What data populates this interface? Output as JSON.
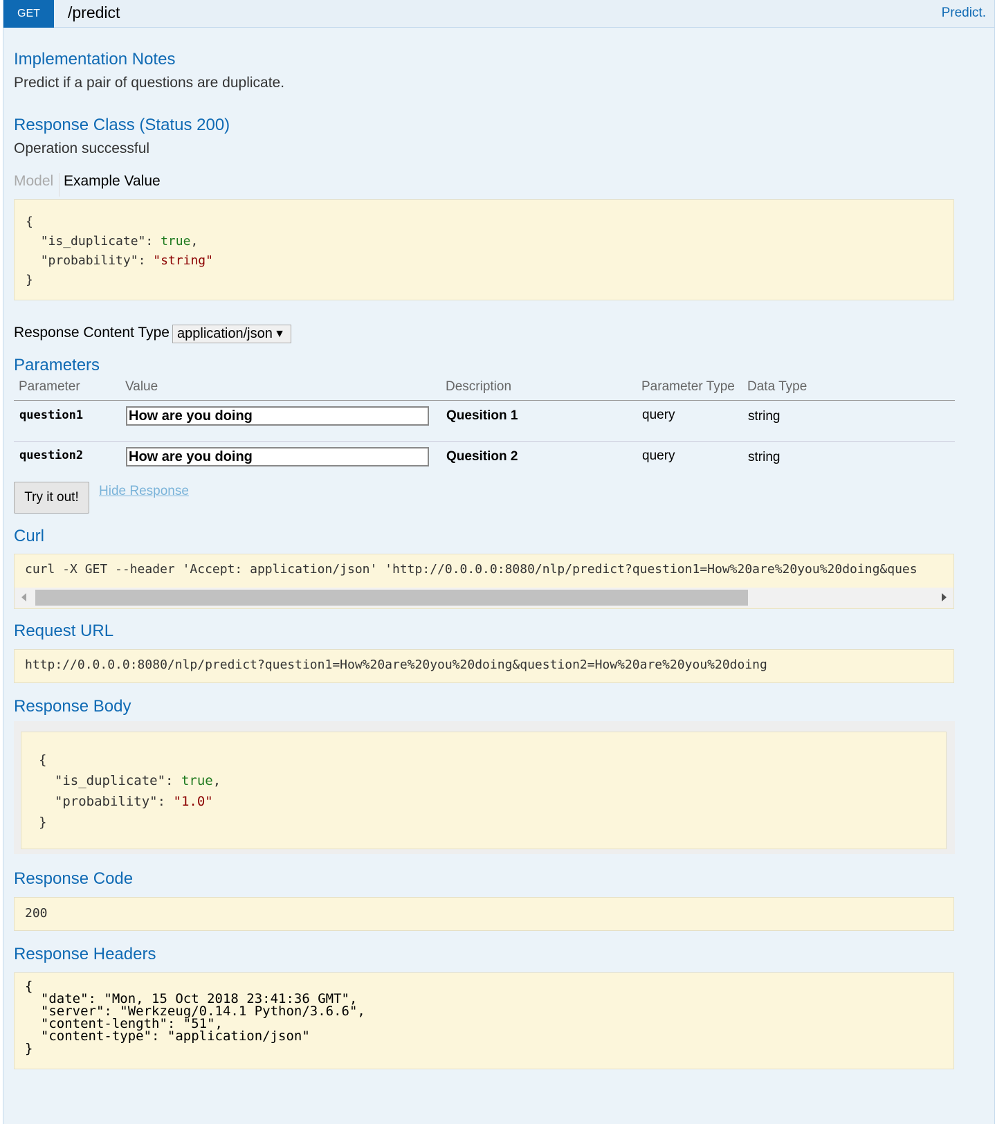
{
  "header": {
    "method": "GET",
    "path": "/predict",
    "summary": "Predict."
  },
  "implementation_notes": {
    "title": "Implementation Notes",
    "text": "Predict if a pair of questions are duplicate."
  },
  "response_class": {
    "title": "Response Class (Status 200)",
    "text": "Operation successful",
    "tabs": {
      "model": "Model",
      "example": "Example Value"
    },
    "example": {
      "open": "{",
      "key1": "\"is_duplicate\"",
      "val1": "true",
      "key2": "\"probability\"",
      "val2": "\"string\"",
      "close": "}"
    }
  },
  "content_type": {
    "label": "Response Content Type",
    "selected": "application/json",
    "arrow": "▼"
  },
  "parameters": {
    "title": "Parameters",
    "columns": [
      "Parameter",
      "Value",
      "Description",
      "Parameter Type",
      "Data Type"
    ],
    "rows": [
      {
        "name": "question1",
        "value": "How are you doing",
        "description": "Quesition 1",
        "param_type": "query",
        "data_type": "string"
      },
      {
        "name": "question2",
        "value": "How are you doing",
        "description": "Quesition 2",
        "param_type": "query",
        "data_type": "string"
      }
    ]
  },
  "actions": {
    "try": "Try it out!",
    "hide": "Hide Response"
  },
  "curl": {
    "title": "Curl",
    "command": "curl -X GET --header 'Accept: application/json' 'http://0.0.0.0:8080/nlp/predict?question1=How%20are%20you%20doing&ques"
  },
  "request_url": {
    "title": "Request URL",
    "url": "http://0.0.0.0:8080/nlp/predict?question1=How%20are%20you%20doing&question2=How%20are%20you%20doing"
  },
  "response_body": {
    "title": "Response Body",
    "open": "{",
    "key1": "\"is_duplicate\"",
    "val1": "true",
    "key2": "\"probability\"",
    "val2": "\"1.0\"",
    "close": "}"
  },
  "response_code": {
    "title": "Response Code",
    "code": "200"
  },
  "response_headers": {
    "title": "Response Headers",
    "lines": [
      "{",
      "  \"date\": \"Mon, 15 Oct 2018 23:41:36 GMT\",",
      "  \"server\": \"Werkzeug/0.14.1 Python/3.6.6\",",
      "  \"content-length\": \"51\",",
      "  \"content-type\": \"application/json\"",
      "}"
    ]
  }
}
